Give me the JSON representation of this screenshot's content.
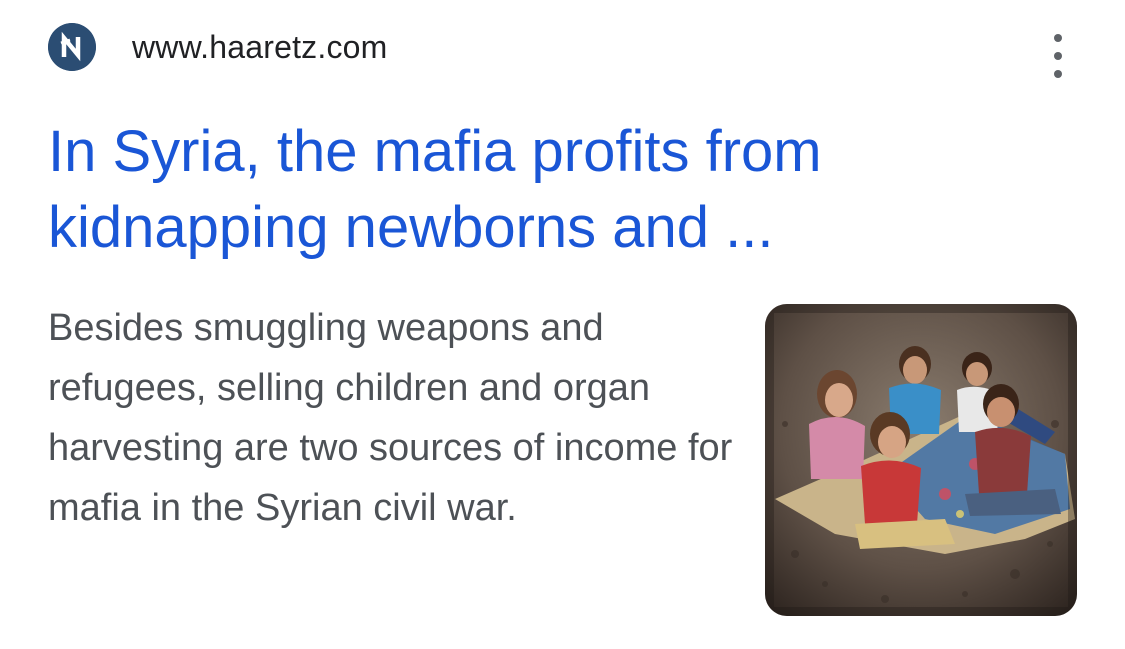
{
  "result": {
    "site_url": "www.haaretz.com",
    "favicon_icon": "haaretz-logo-icon",
    "more_icon": "more-vert-icon",
    "title": "In Syria, the mafia profits from kidnapping newborns and ...",
    "snippet": "Besides smuggling weapons and refugees, selling children and organ harvesting are two sources of income for mafia in the Syrian civil war.",
    "thumbnail_icon": "children-on-blanket-photo"
  },
  "colors": {
    "title_link": "#1a56d6",
    "url_text": "#202124",
    "snippet_text": "#4d5156",
    "favicon_bg": "#2b4d73"
  }
}
